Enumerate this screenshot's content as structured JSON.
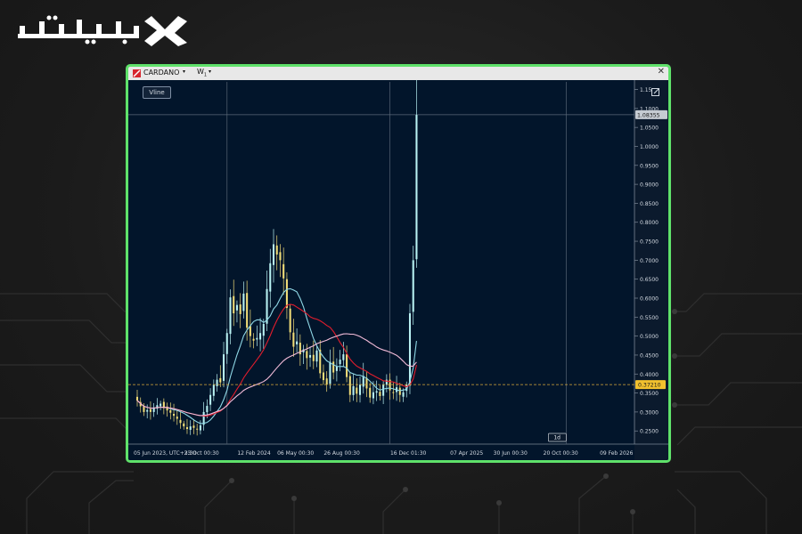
{
  "brand": {
    "logo_text": "تیوبیت",
    "bg_color": "#1c1c1c",
    "frame_color": "#5fe16a"
  },
  "window": {
    "symbol": "CARDANO",
    "timeframe": "W",
    "timeframe_sub": "1",
    "dropdown_glyph": "▾",
    "close_glyph": "✕",
    "vline_label": "Vline"
  },
  "chart_data": {
    "type": "candlestick",
    "title": "",
    "xlabel": "",
    "ylabel": "",
    "ylim": [
      0.22,
      1.17
    ],
    "y_ticks": [
      "0.2500",
      "0.3000",
      "0.3500",
      "0.4000",
      "0.4500",
      "0.5000",
      "0.5500",
      "0.6000",
      "0.6500",
      "0.7000",
      "0.7500",
      "0.8000",
      "0.8500",
      "0.9000",
      "0.9500",
      "1.0000",
      "1.0500",
      "1.1000",
      "1.15"
    ],
    "y_tick_values": [
      0.25,
      0.3,
      0.35,
      0.4,
      0.45,
      0.5,
      0.55,
      0.6,
      0.65,
      0.7,
      0.75,
      0.8,
      0.85,
      0.9,
      0.95,
      1.0,
      1.05,
      1.1,
      1.15
    ],
    "x_ticks": [
      "05 Jun 2023, UTC+3:30",
      "23 Oct 00:30",
      "12 Feb 2024",
      "06 May 00:30",
      "26 Aug 00:30",
      "16 Dec 01:30",
      "07 Apr 2025",
      "30 Jun 00:30",
      "20 Oct 00:30",
      "09 Feb 2026"
    ],
    "x_tick_index": [
      0,
      20,
      36,
      48,
      62,
      82,
      100,
      113,
      128,
      145
    ],
    "vertical_lines_index": [
      27,
      76,
      129
    ],
    "crosshair": {
      "value": 1.08355,
      "label": "1.08355"
    },
    "last_price": {
      "value": 0.3721,
      "label": "0.37210"
    },
    "timeframe_badge": "1d",
    "close_series": [
      0.33,
      0.315,
      0.3,
      0.305,
      0.3,
      0.312,
      0.318,
      0.322,
      0.31,
      0.304,
      0.298,
      0.29,
      0.282,
      0.271,
      0.262,
      0.255,
      0.262,
      0.258,
      0.255,
      0.265,
      0.3,
      0.316,
      0.345,
      0.372,
      0.385,
      0.378,
      0.452,
      0.508,
      0.602,
      0.56,
      0.582,
      0.558,
      0.612,
      0.522,
      0.5,
      0.488,
      0.495,
      0.508,
      0.532,
      0.624,
      0.692,
      0.742,
      0.715,
      0.7,
      0.652,
      0.574,
      0.51,
      0.472,
      0.486,
      0.452,
      0.465,
      0.442,
      0.45,
      0.434,
      0.462,
      0.402,
      0.384,
      0.372,
      0.432,
      0.404,
      0.42,
      0.438,
      0.452,
      0.392,
      0.345,
      0.368,
      0.348,
      0.372,
      0.395,
      0.362,
      0.338,
      0.352,
      0.355,
      0.342,
      0.372,
      0.385,
      0.357,
      0.352,
      0.365,
      0.345,
      0.352,
      0.372,
      0.56,
      0.7,
      1.083
    ],
    "series": [
      {
        "name": "",
        "color": "#8fd8e6",
        "period": 10
      },
      {
        "name": "",
        "color": "#e21d2d",
        "period": 20
      },
      {
        "name": "",
        "color": "#f3bcd9",
        "period": 40
      }
    ],
    "colors": {
      "up": "#b9f2f3",
      "down": "#f2dd78",
      "grid": "#3c4a5a",
      "bg": "#02152b"
    }
  }
}
